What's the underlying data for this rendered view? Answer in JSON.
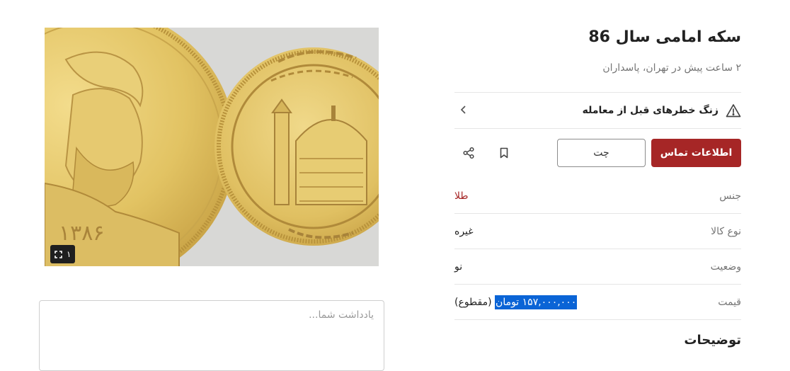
{
  "listing": {
    "title": "سکه امامی سال 86",
    "subtitle": "۲ ساعت پیش در تهران، پاسداران",
    "image_counter": "۱"
  },
  "warning": {
    "label": "زنگ خطرهای قبل از معامله"
  },
  "actions": {
    "contact_label": "اطلاعات تماس",
    "chat_label": "چت"
  },
  "attributes": [
    {
      "key": "جنس",
      "value": "طلا",
      "is_link": true
    },
    {
      "key": "نوع کالا",
      "value": "غیره",
      "is_link": false
    },
    {
      "key": "وضعیت",
      "value": "نو",
      "is_link": false
    }
  ],
  "price": {
    "key": "قیمت",
    "amount": "۱۵۷,۰۰۰,۰۰۰ تومان",
    "suffix": "(مقطوع)"
  },
  "notes": {
    "placeholder": "یادداشت شما..."
  },
  "description": {
    "heading": "توضیحات"
  },
  "icons": {
    "warning": "warning-triangle-icon",
    "chevron": "chevron-left-icon",
    "bookmark": "bookmark-icon",
    "share": "share-icon",
    "expand": "expand-icon"
  },
  "colors": {
    "brand_red": "#a62626",
    "selection_blue": "#0a64d6",
    "gold": "#d9c38a"
  }
}
